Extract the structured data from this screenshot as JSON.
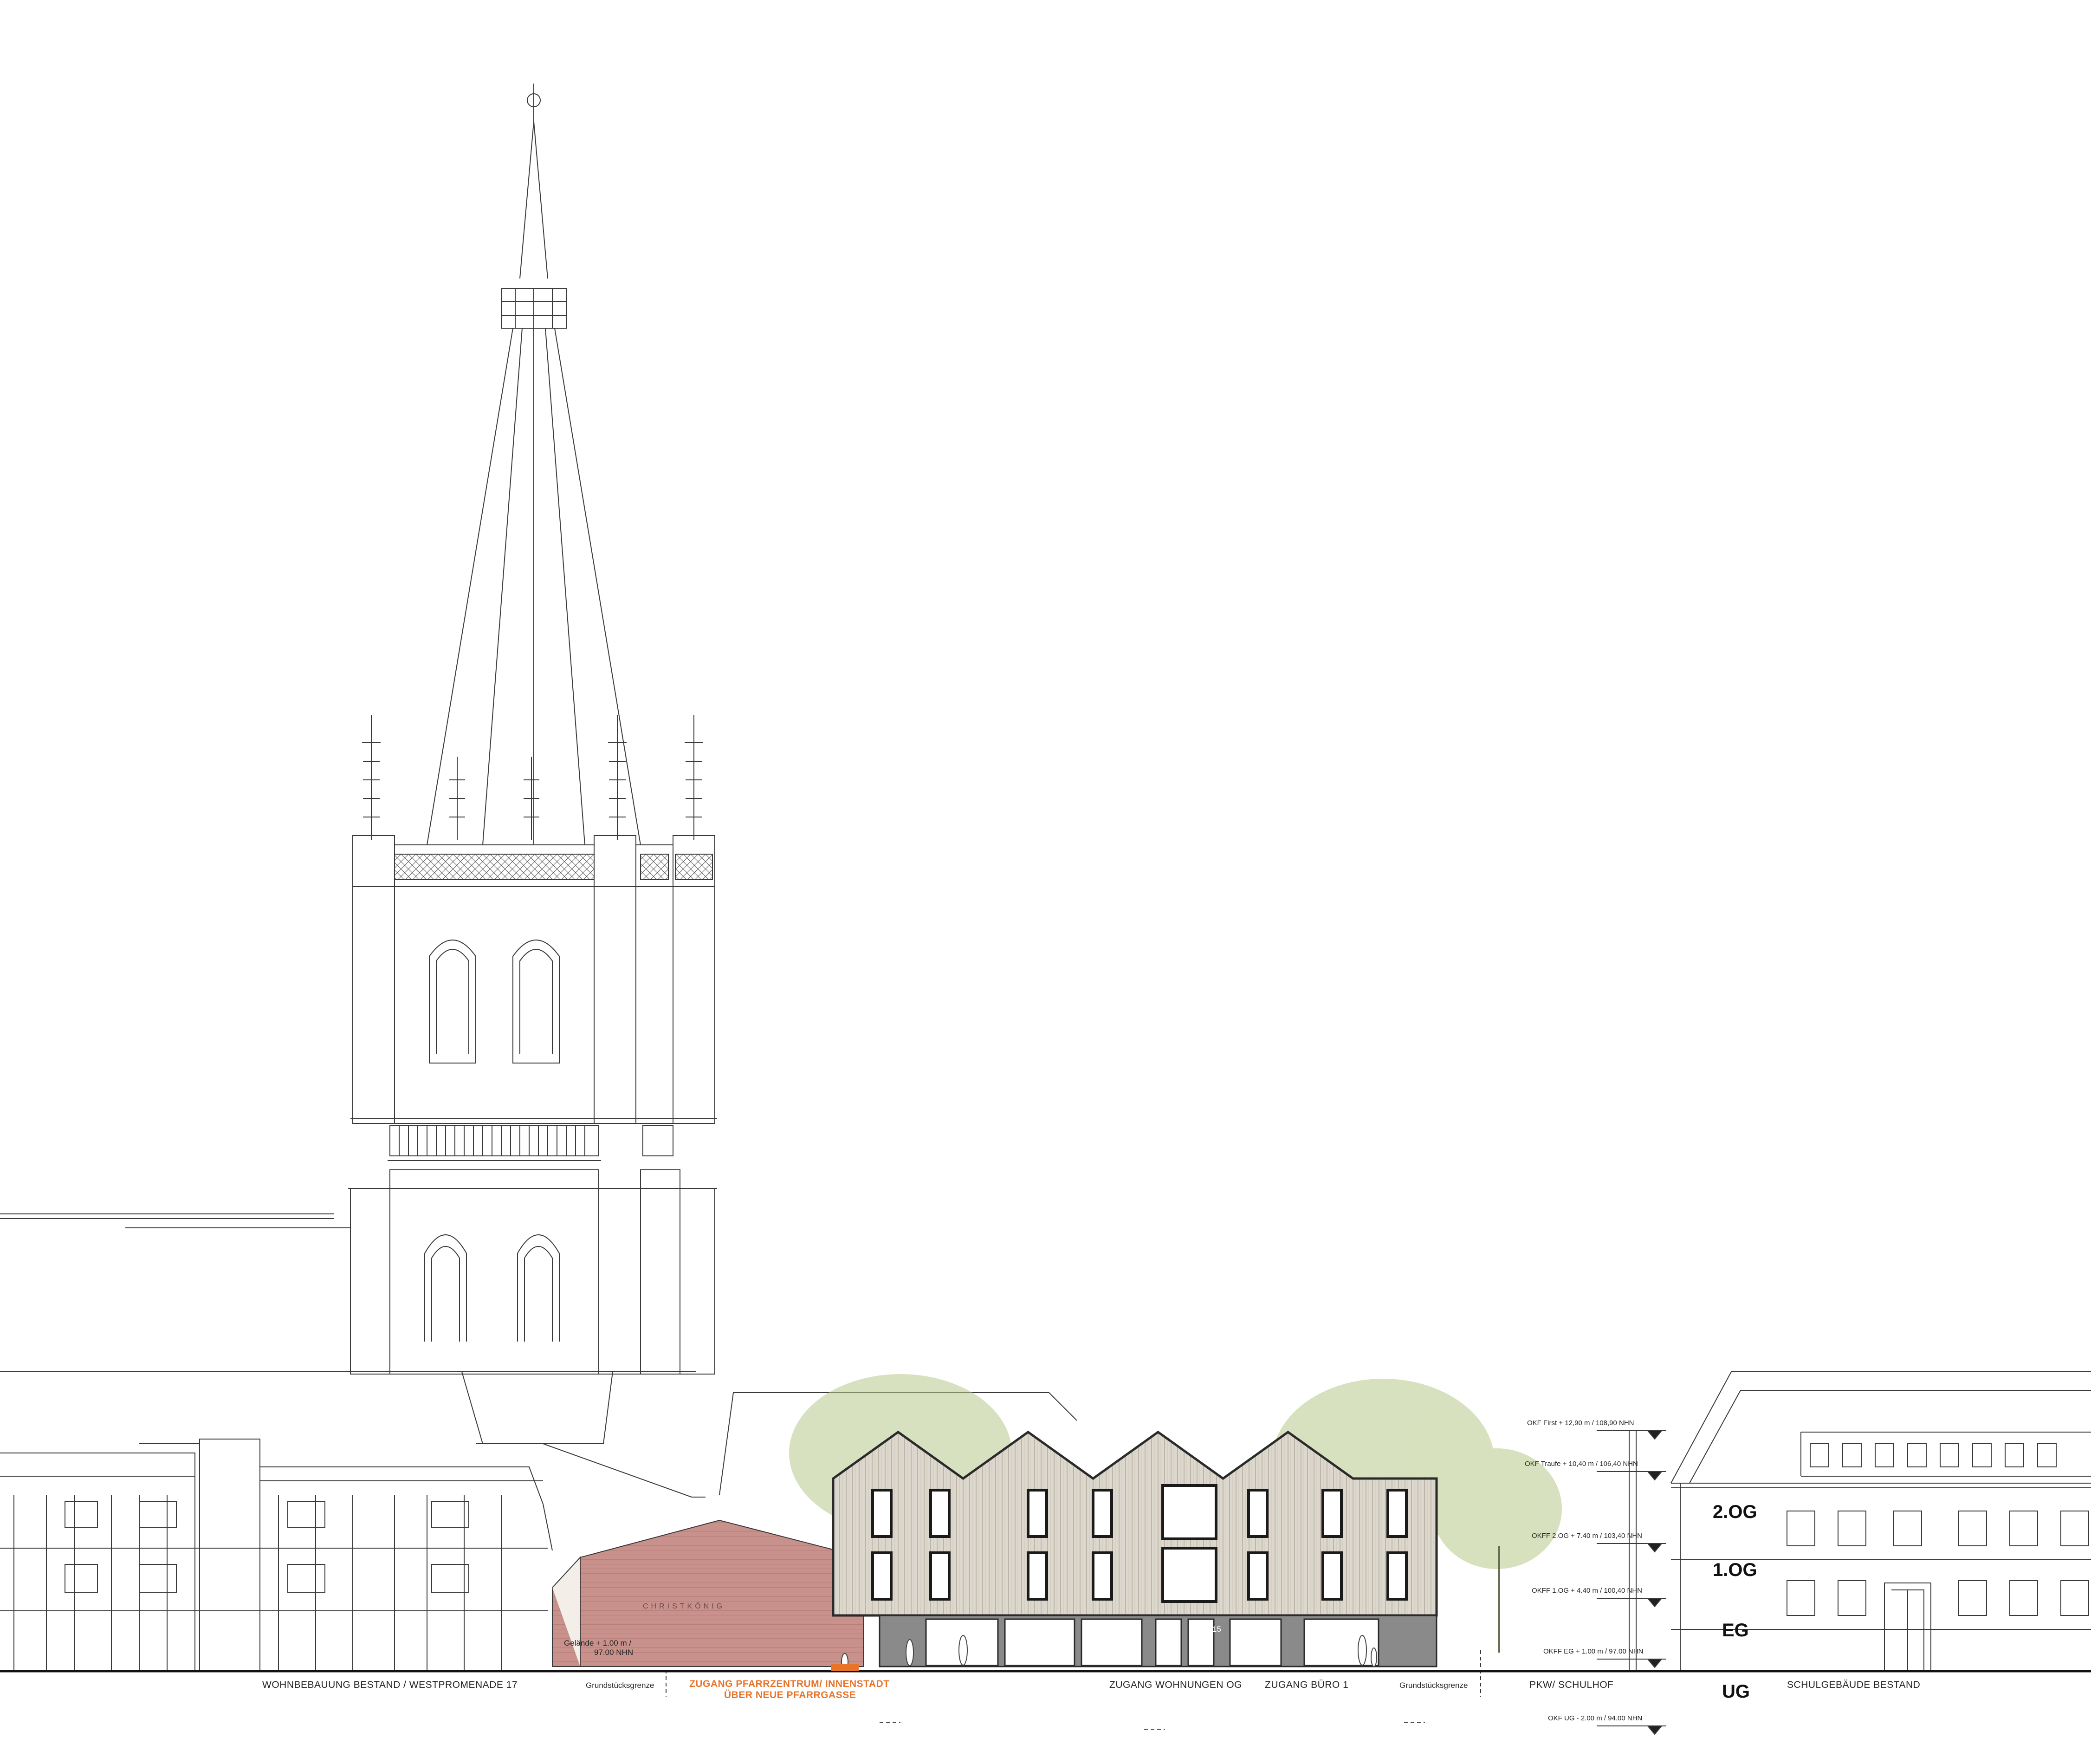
{
  "elevation": {
    "labels": {
      "wohnbebauung": "WOHNBEBAUUNG BESTAND / WESTPROMENADE 17",
      "grenze_left": "Grundstücksgrenze",
      "zugang_line1": "ZUGANG PFARRZENTRUM/ INNENSTADT",
      "zugang_line2": "ÜBER NEUE PFARRGASSE",
      "zugang_wohnungen": "ZUGANG WOHNUNGEN OG",
      "zugang_buero": "ZUGANG BÜRO 1",
      "grenze_right": "Grundstücksgrenze",
      "pkw": "PKW/ SCHULHOF",
      "schulgebaeude": "SCHULGEBÄUDE BESTAND",
      "gelaende_line1": "Gelände + 1.00 m /",
      "gelaende_line2": "97.00 NHN",
      "church_sign": "CHRISTKÖNIG",
      "door_number": "15"
    },
    "floors": {
      "og2": "2.OG",
      "og1": "1.OG",
      "eg": "EG",
      "ug": "UG"
    },
    "levels": {
      "first": "OKF First + 12,90 m / 108,90 NHN",
      "traufe": "OKF Traufe + 10,40 m / 106,40 NHN",
      "og2": "OKFF 2.OG + 7.40 m / 103,40 NHN",
      "og1": "OKFF 1.OG + 4.40 m / 100,40 NHN",
      "eg": "OKFF EG + 1.00 m / 97.00 NHN",
      "ug": "OKF UG - 2.00 m / 94.00 NHN"
    },
    "colors": {
      "line": "#3a3a3a",
      "brick": "#c9918c",
      "cladding": "#ddd8cd",
      "ground_floor": "#8a8a8a",
      "accent": "#e8742a",
      "tree": "#b7c98a"
    }
  }
}
